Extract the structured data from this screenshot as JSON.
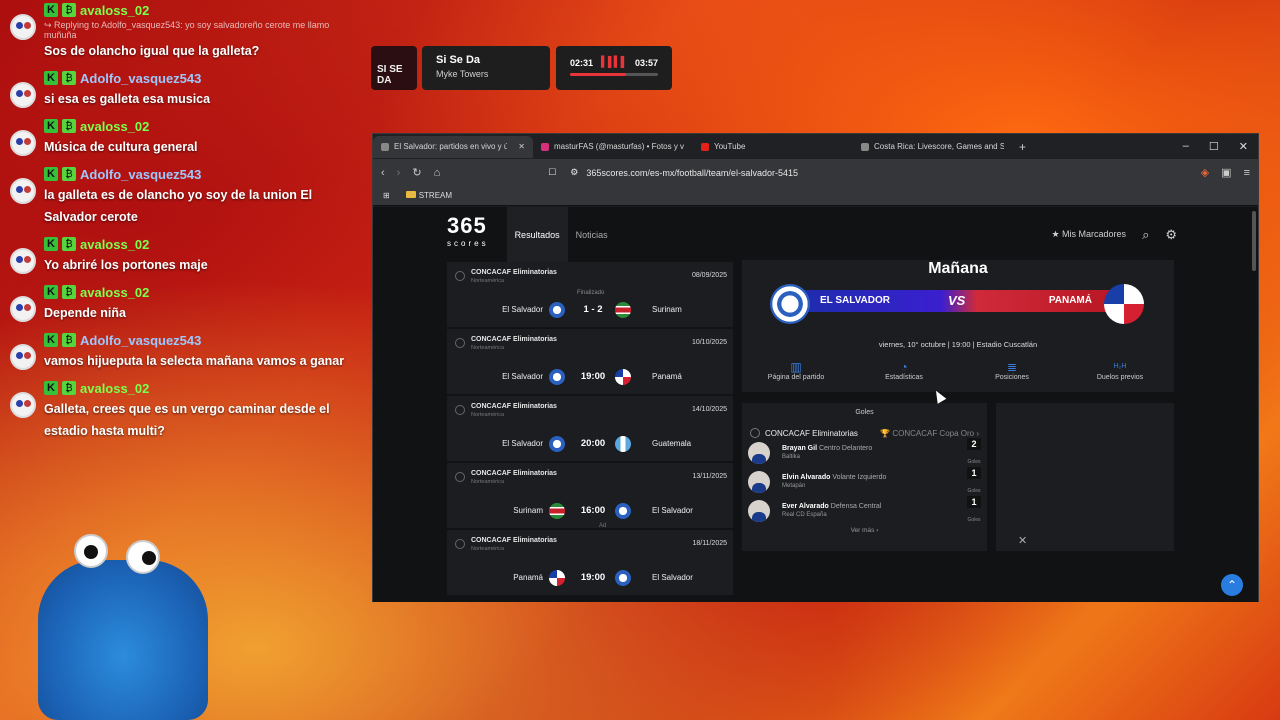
{
  "chat": [
    {
      "user": "avaloss_02",
      "color": "green",
      "reply": "Replying to Adolfo_vasquez543: yo soy salvadoreño cerote me llamo muñuña",
      "text": "Sos de olancho igual que la galleta?"
    },
    {
      "user": "Adolfo_vasquez543",
      "color": "blue",
      "reply": "",
      "text": "si esa es galleta esa musica"
    },
    {
      "user": "avaloss_02",
      "color": "green",
      "reply": "",
      "text": "Música de cultura general"
    },
    {
      "user": "Adolfo_vasquez543",
      "color": "blue",
      "reply": "",
      "text": "la galleta es de olancho yo soy de la union El Salvador cerote"
    },
    {
      "user": "avaloss_02",
      "color": "green",
      "reply": "",
      "text": "Yo abriré los portones maje"
    },
    {
      "user": "avaloss_02",
      "color": "green",
      "reply": "",
      "text": "Depende niña"
    },
    {
      "user": "Adolfo_vasquez543",
      "color": "blue",
      "reply": "",
      "text": "vamos hijueputa la selecta mañana vamos a ganar"
    },
    {
      "user": "avaloss_02",
      "color": "green",
      "reply": "",
      "text": "Galleta, crees que es un vergo caminar desde el estadio hasta multi?"
    }
  ],
  "badges": {
    "k": "K",
    "g": "₿"
  },
  "now_playing": {
    "art_text": "SI SE DA",
    "title": "Si Se Da",
    "artist": "Myke Towers",
    "elapsed": "02:31",
    "total": "03:57",
    "progress": 0.64
  },
  "browser": {
    "tabs": [
      {
        "label": "El Salvador: partidos en vivo y úl",
        "active": true
      },
      {
        "label": "masturFAS (@masturfas) • Fotos y vi",
        "active": false
      },
      {
        "label": "YouTube",
        "active": false
      },
      {
        "label": "Costa Rica: Livescore, Games and Sch",
        "active": false
      }
    ],
    "url": "365scores.com/es-mx/football/team/el-salvador-5415",
    "bookmark": "STREAM"
  },
  "site": {
    "logo_top": "365",
    "logo_bottom": "scores",
    "nav": [
      "Resultados",
      "Noticias"
    ],
    "favorites": "Mis Marcadores"
  },
  "matches": [
    {
      "comp": "CONCACAF Eliminatorias",
      "region": "Norteamérica",
      "date": "08/09/2025",
      "status": "Finalizado",
      "home": "El Salvador",
      "center": "1 - 2",
      "away": "Surinam",
      "ad": ""
    },
    {
      "comp": "CONCACAF Eliminatorias",
      "region": "Norteamérica",
      "date": "10/10/2025",
      "status": "",
      "home": "El Salvador",
      "center": "19:00",
      "away": "Panamá",
      "ad": ""
    },
    {
      "comp": "CONCACAF Eliminatorias",
      "region": "Norteamérica",
      "date": "14/10/2025",
      "status": "",
      "home": "El Salvador",
      "center": "20:00",
      "away": "Guatemala",
      "ad": ""
    },
    {
      "comp": "CONCACAF Eliminatorias",
      "region": "Norteamérica",
      "date": "13/11/2025",
      "status": "",
      "home": "Surinam",
      "center": "16:00",
      "away": "El Salvador",
      "ad": "Ad"
    },
    {
      "comp": "CONCACAF Eliminatorias",
      "region": "Norteamérica",
      "date": "18/11/2025",
      "status": "",
      "home": "Panamá",
      "center": "19:00",
      "away": "El Salvador",
      "ad": ""
    }
  ],
  "hero": {
    "when": "Mañana",
    "home": "EL SALVADOR",
    "vs": "VS",
    "away": "PANAMÁ",
    "info": "viernes, 10° octubre | 19:00 | Estadio Cuscatlán",
    "tabs": [
      {
        "icon": "chart-icon",
        "label": "Página del partido"
      },
      {
        "icon": "stats-icon",
        "label": "Estadísticas"
      },
      {
        "icon": "list-icon",
        "label": "Posiciones"
      },
      {
        "icon": "h2h-icon",
        "label": "Duelos previos"
      }
    ]
  },
  "scorers": {
    "title": "Goles",
    "comp": "CONCACAF Eliminatorias",
    "other_comp": "CONCACAF Copa Oro",
    "players": [
      {
        "name": "Brayan Gil",
        "pos": "Centro Delantero",
        "club": "Baltika",
        "goals": "2",
        "unit": "Goles"
      },
      {
        "name": "Elvin Alvarado",
        "pos": "Volante Izquierdo",
        "club": "Metapán",
        "goals": "1",
        "unit": "Goles"
      },
      {
        "name": "Ever Alvarado",
        "pos": "Defensa Central",
        "club": "Real CD España",
        "goals": "1",
        "unit": "Goles"
      }
    ],
    "more": "Ver más"
  }
}
